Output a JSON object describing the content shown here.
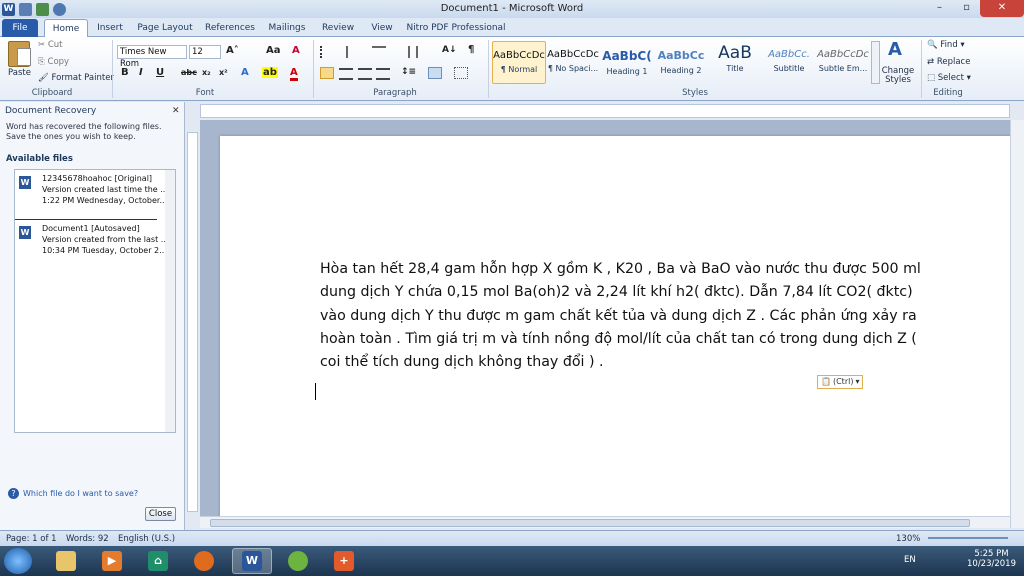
{
  "window": {
    "title": "Document1 - Microsoft Word"
  },
  "tabs": [
    "File",
    "Home",
    "Insert",
    "Page Layout",
    "References",
    "Mailings",
    "Review",
    "View",
    "Nitro PDF Professional"
  ],
  "ribbon": {
    "clipboard": {
      "label": "Clipboard",
      "paste": "Paste",
      "cut": "Cut",
      "copy": "Copy",
      "format_painter": "Format Painter"
    },
    "font": {
      "label": "Font",
      "family": "Times New Rom",
      "size": "12"
    },
    "paragraph": {
      "label": "Paragraph"
    },
    "styles": {
      "label": "Styles",
      "items": [
        {
          "sample": "AaBbCcDc",
          "name": "¶ Normal"
        },
        {
          "sample": "AaBbCcDc",
          "name": "¶ No Spaci..."
        },
        {
          "sample": "AaBbC(",
          "name": "Heading 1"
        },
        {
          "sample": "AaBbCc",
          "name": "Heading 2"
        },
        {
          "sample": "AaB",
          "name": "Title"
        },
        {
          "sample": "AaBbCc.",
          "name": "Subtitle"
        },
        {
          "sample": "AaBbCcDc",
          "name": "Subtle Em..."
        }
      ],
      "change_styles": "Change Styles"
    },
    "editing": {
      "label": "Editing",
      "find": "Find",
      "replace": "Replace",
      "select": "Select"
    }
  },
  "recovery": {
    "title": "Document Recovery",
    "message": "Word has recovered the following files.  Save the ones you wish to keep.",
    "available": "Available files",
    "files": [
      {
        "name": "12345678hoahoc  [Original]",
        "line2": "Version created last time the ...",
        "line3": "1:22 PM Wednesday, October..."
      },
      {
        "name": "Document1  [Autosaved]",
        "line2": "Version created from the last ...",
        "line3": "10:34 PM Tuesday, October 2..."
      }
    ],
    "help": "Which file do I want to save?",
    "close": "Close"
  },
  "document": {
    "text": "Hòa tan hết 28,4 gam hỗn hợp X gồm K , K20 , Ba và BaO vào nước thu được 500 ml dung dịch Y chứa 0,15 mol Ba(oh)2 và 2,24 lít khí h2( đktc). Dẫn 7,84 lít CO2( đktc) vào dung dịch Y thu được m gam chất kết tủa và dung dịch Z . Các phản ứng xảy ra hoàn toàn . Tìm giá trị m và tính nồng độ mol/lít của chất tan có trong dung dịch Z ( coi thể tích dung dịch không thay đổi ) .",
    "paste_option": "(Ctrl)"
  },
  "status": {
    "page": "Page: 1 of 1",
    "words": "Words: 92",
    "language": "English (U.S.)",
    "zoom": "130%"
  },
  "taskbar": {
    "lang": "EN",
    "time": "5:25 PM",
    "date": "10/23/2019"
  }
}
